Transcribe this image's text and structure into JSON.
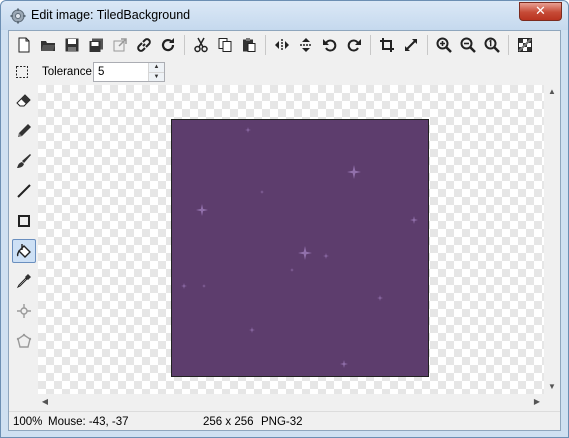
{
  "window": {
    "title": "Edit image: TiledBackground",
    "close_label": "✕"
  },
  "toolbar": {
    "buttons": [
      {
        "name": "new-file-icon"
      },
      {
        "name": "open-folder-icon"
      },
      {
        "name": "save-icon"
      },
      {
        "name": "save-copy-icon"
      },
      {
        "name": "external-edit-icon"
      },
      {
        "name": "link-icon"
      },
      {
        "name": "refresh-icon"
      },
      {
        "name": "cut-icon"
      },
      {
        "name": "copy-icon"
      },
      {
        "name": "paste-icon"
      },
      {
        "name": "flip-horizontal-icon"
      },
      {
        "name": "flip-vertical-icon"
      },
      {
        "name": "rotate-left-icon"
      },
      {
        "name": "rotate-right-icon"
      },
      {
        "name": "crop-icon"
      },
      {
        "name": "resize-icon"
      },
      {
        "name": "zoom-in-icon"
      },
      {
        "name": "zoom-out-icon"
      },
      {
        "name": "zoom-actual-icon"
      },
      {
        "name": "transparency-grid-icon"
      }
    ]
  },
  "options": {
    "tolerance_label": "Tolerance",
    "tolerance_value": "5"
  },
  "tools": [
    {
      "name": "eraser-tool-icon",
      "active": false
    },
    {
      "name": "pencil-tool-icon",
      "active": false
    },
    {
      "name": "brush-tool-icon",
      "active": false
    },
    {
      "name": "line-tool-icon",
      "active": false
    },
    {
      "name": "rectangle-tool-icon",
      "active": false
    },
    {
      "name": "fill-bucket-tool-icon",
      "active": true
    },
    {
      "name": "eyedropper-tool-icon",
      "active": false
    },
    {
      "name": "move-tool-icon",
      "active": false
    },
    {
      "name": "polygon-tool-icon",
      "active": false
    }
  ],
  "image": {
    "fill_color": "#5d3d6d",
    "sparkle_color": "#9b79b6"
  },
  "status": {
    "zoom": "100%",
    "mouse": "Mouse: -43, -37",
    "dimensions": "256 x 256",
    "format": "PNG-32"
  }
}
